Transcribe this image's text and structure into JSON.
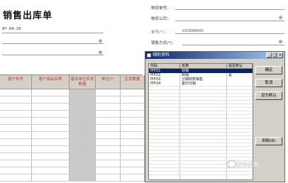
{
  "form": {
    "title": "销售出库单",
    "date": "07-09-29",
    "fields": [
      {
        "label": "物流单号：",
        "value": ""
      },
      {
        "label": "物流公司：",
        "value": ""
      },
      {
        "label": "单号(*)：",
        "value": "XSCK000041"
      },
      {
        "label": "销售方式(*)：",
        "value": ""
      }
    ]
  },
  "grid": {
    "headers": [
      "客户料号",
      "客户商品名称",
      "基本单位实发数量",
      "单位(*)",
      "应发数量"
    ]
  },
  "dialog": {
    "title": "辅助资料",
    "columns": [
      "代码",
      "名称",
      "是否默认"
    ],
    "rows": [
      {
        "code": "PIFO1",
        "name": "现销",
        "default": ""
      },
      {
        "code": "PIFO2",
        "name": "赊销",
        "default": "是"
      },
      {
        "code": "PIFO3",
        "name": "分期收款销售",
        "default": ""
      },
      {
        "code": "PIFO4",
        "name": "委托代销",
        "default": ""
      }
    ],
    "buttons": {
      "ok": "确定",
      "cancel": "取消",
      "set_default": "设为默认",
      "refresh": "刷新(R)"
    }
  },
  "watermark": "软件实务"
}
